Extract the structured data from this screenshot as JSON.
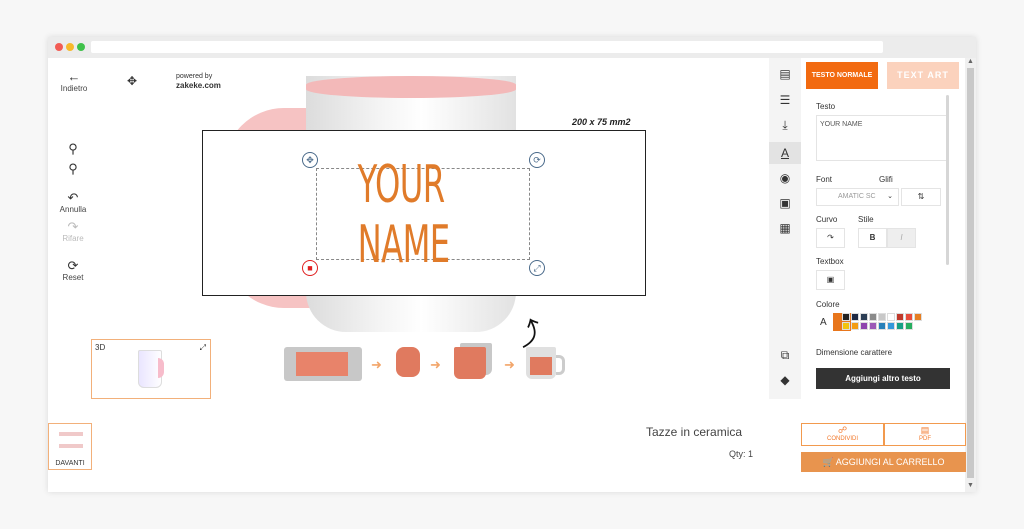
{
  "toolbar_left": {
    "back": {
      "label": "Indietro",
      "icon": "arrow-left-icon"
    },
    "zoom_in_icon": "zoom-in-icon",
    "zoom_out_icon": "zoom-out-icon",
    "undo": {
      "label": "Annulla",
      "icon": "undo-icon"
    },
    "redo": {
      "label": "Rifare",
      "icon": "redo-icon"
    },
    "reset": {
      "label": "Reset",
      "icon": "reset-icon"
    }
  },
  "powered": {
    "line1": "powered by",
    "line2": "zakeke.com"
  },
  "canvas": {
    "print_area_label": "200 x 75 mm2",
    "text_value": "YOUR NAME",
    "text_color": "#e07b2a"
  },
  "thumb3d": {
    "label": "3D"
  },
  "side_selector": {
    "label": "DAVANTI"
  },
  "right_rail": {
    "icons": [
      "page-icon",
      "adjustments-icon",
      "upload-icon",
      "text-icon",
      "palette-icon",
      "template-icon",
      "grid-icon",
      "copy-icon",
      "layers-icon"
    ],
    "active_index": 3
  },
  "text_panel": {
    "mode_normal": "TESTO NORMALE",
    "mode_art": "TEXT ART",
    "testo_label": "Testo",
    "testo_value": "YOUR NAME",
    "font_label": "Font",
    "glyph_label": "Glifi",
    "font_value": "AMATIC SC",
    "curved_label": "Curvo",
    "style_label": "Stile",
    "bold": "B",
    "italic": "I",
    "textbox_label": "Textbox",
    "color_label": "Colore",
    "color_letter": "A",
    "selected_color": "#e8761c",
    "palette": [
      "#222222",
      "#1f2a44",
      "#2c3e55",
      "#8a8a8a",
      "#c8c8c8",
      "#ffffff",
      "#c0392b",
      "#e74c3c",
      "#e67e22",
      "#f1c40f",
      "#f39c12",
      "#8e44ad",
      "#9b59b6",
      "#2980b9",
      "#3498db",
      "#16a085",
      "#27ae60"
    ],
    "size_label": "Dimensione carattere",
    "add_text": "Aggiungi altro testo"
  },
  "product": {
    "name": "Tazze in ceramica",
    "qty": "Qty: 1"
  },
  "actions": {
    "share": "CONDIVIDI",
    "pdf": "PDF",
    "add_to_cart": "AGGIUNGI AL CARRELLO"
  },
  "accent_color": "#f26a10"
}
